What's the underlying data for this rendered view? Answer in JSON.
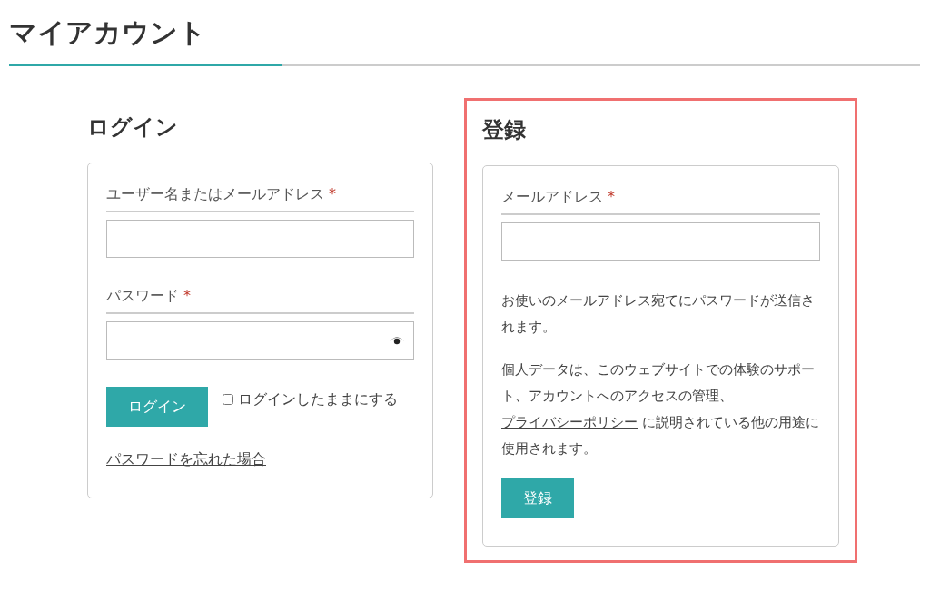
{
  "page": {
    "title": "マイアカウント"
  },
  "login": {
    "heading": "ログイン",
    "fields": [
      {
        "label": "ユーザー名またはメールアドレス",
        "required_mark": "*",
        "kind": "text"
      },
      {
        "label": "パスワード",
        "required_mark": "*",
        "kind": "password"
      }
    ],
    "button": "ログイン",
    "remember": {
      "label": "ログインしたままにする",
      "checked": false
    },
    "lost_password": "パスワードを忘れた場合"
  },
  "register": {
    "highlighted": true,
    "heading": "登録",
    "fields": [
      {
        "label": "メールアドレス",
        "required_mark": "*",
        "kind": "text"
      }
    ],
    "note": "お使いのメールアドレス宛てにパスワードが送信されます。",
    "privacy": {
      "before": "個人データは、このウェブサイトでの体験のサポート、アカウントへのアクセスの管理、",
      "link": "プライバシーポリシー",
      "after": " に説明されている他の用途に使用されます。"
    },
    "button": "登録"
  }
}
